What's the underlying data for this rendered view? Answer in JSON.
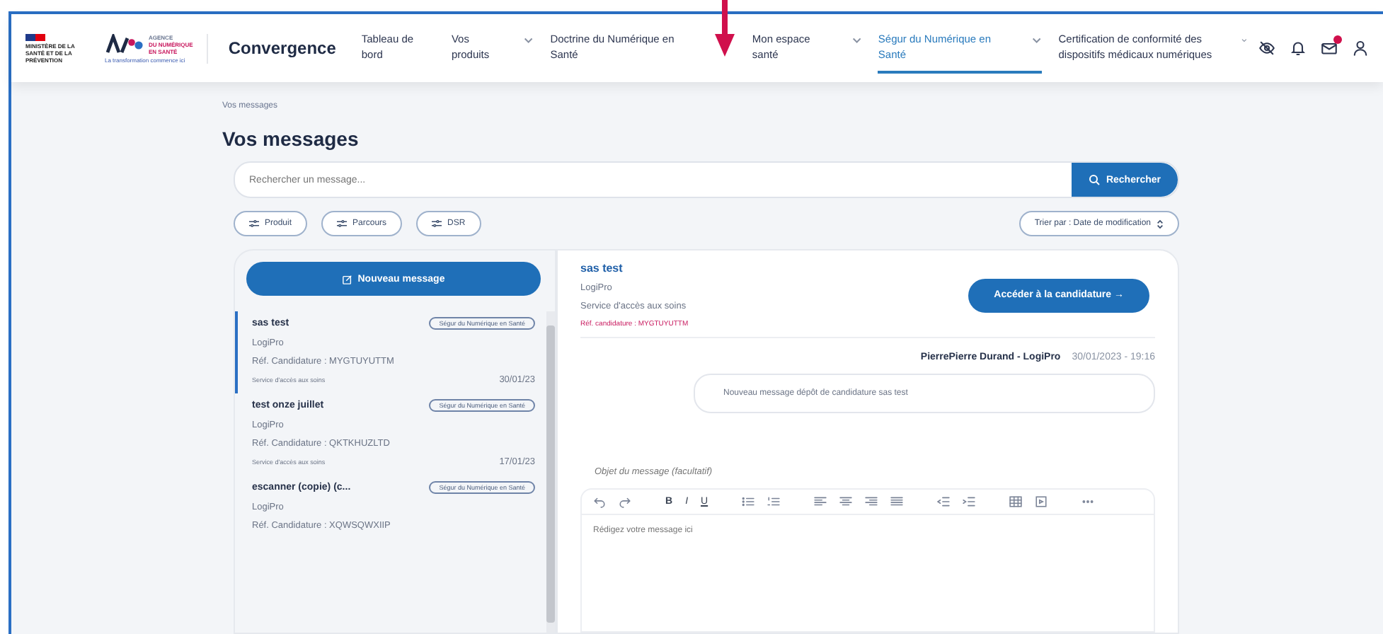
{
  "header": {
    "ministry": "MINISTÈRE DE LA SANTÉ ET DE LA PRÉVENTION",
    "agency": [
      "AGENCE",
      "DU NUMÉRIQUE",
      "EN SANTÉ"
    ],
    "agency_tagline": "La transformation commence ici",
    "app_name": "Convergence",
    "has_notification": true
  },
  "nav": [
    {
      "label": "Tableau de bord",
      "dropdown": false,
      "selected": false
    },
    {
      "label": "Vos produits",
      "dropdown": true,
      "selected": false
    },
    {
      "label": "Doctrine du Numérique en Santé",
      "dropdown": false,
      "selected": false
    },
    {
      "label": "Mon espace santé",
      "dropdown": true,
      "selected": false
    },
    {
      "label": "Ségur du Numérique en Santé",
      "dropdown": true,
      "selected": true
    },
    {
      "label": "Certification de conformité des dispositifs médicaux numériques",
      "dropdown": true,
      "selected": false
    }
  ],
  "breadcrumb": "Vos messages",
  "title": "Vos messages",
  "search": {
    "placeholder": "Rechercher un message...",
    "button": "Rechercher"
  },
  "filters": [
    "Produit",
    "Parcours",
    "DSR"
  ],
  "sort": "Trier par : Date de modification",
  "new_message": "Nouveau message",
  "messages": [
    {
      "title": "sas test",
      "tag": "Ségur du Numérique en Santé",
      "product": "LogiPro",
      "ref": "Réf. Candidature : MYGTUYUTTM",
      "service": "Service d'accès aux soins",
      "date": "30/01/23",
      "selected": true
    },
    {
      "title": "test onze juillet",
      "tag": "Ségur du Numérique en Santé",
      "product": "LogiPro",
      "ref": "Réf. Candidature : QKTKHUZLTD",
      "service": "Service d'accès aux soins",
      "date": "17/01/23",
      "selected": false
    },
    {
      "title": "escanner (copie) (c...",
      "tag": "Ségur du Numérique en Santé",
      "product": "LogiPro",
      "ref": "Réf. Candidature : XQWSQWXIIP",
      "selected": false
    }
  ],
  "detail": {
    "title": "sas test",
    "product": "LogiPro",
    "service": "Service d'accès aux soins",
    "ref": "Réf. candidature : MYGTUYUTTM",
    "button": "Accéder à la candidature →"
  },
  "thread": [
    {
      "author": "PierrePierre Durand - LogiPro",
      "time": "30/01/2023 - 19:16",
      "text": "Nouveau message dépôt de candidature sas test"
    }
  ],
  "composer": {
    "subject_placeholder": "Objet du message (facultatif)",
    "format_buttons": [
      "B",
      "I",
      "U"
    ],
    "body_placeholder": "Rédigez votre message ici"
  }
}
